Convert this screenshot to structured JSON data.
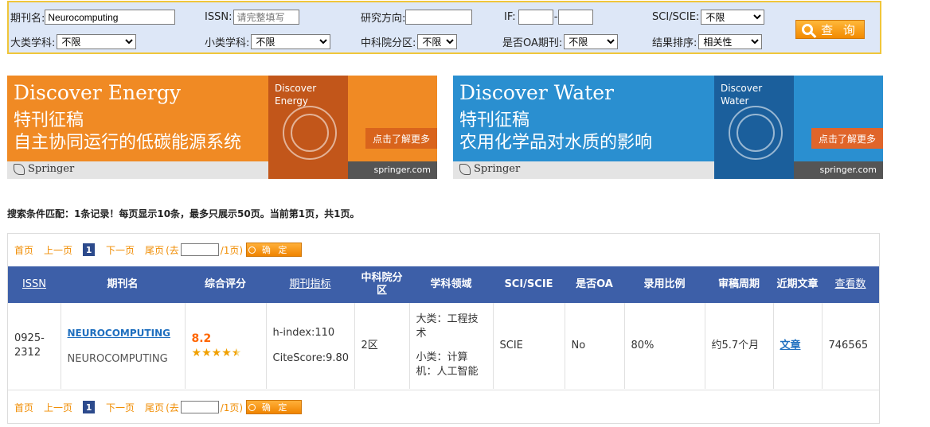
{
  "search": {
    "journal_label": "期刊名:",
    "journal_value": "Neurocomputing",
    "issn_label": "ISSN:",
    "issn_placeholder": "请完整填写",
    "research_label": "研究方向:",
    "research_value": "",
    "if_label": "IF:",
    "if_min": "",
    "if_dash": "-",
    "if_max": "",
    "sci_label": "SCI/SCIE:",
    "sci_value": "不限",
    "major_label": "大类学科:",
    "major_value": "不限",
    "minor_label": "小类学科:",
    "minor_value": "不限",
    "cas_label": "中科院分区:",
    "cas_value": "不限",
    "oa_label": "是否OA期刊:",
    "oa_value": "不限",
    "sort_label": "结果排序:",
    "sort_value": "相关性",
    "query_label": "查 询"
  },
  "banners": [
    {
      "title_en": "Discover Energy",
      "title_zh1": "特刊征稿",
      "title_zh2": "自主协同运行的低碳能源系统",
      "cover_title": "Discover\nEnergy",
      "learn_more": "点击了解更多",
      "brand": "Springer",
      "site": "springer.com",
      "bg_color": "#f08a24",
      "cover_color": "#c2561a"
    },
    {
      "title_en": "Discover Water",
      "title_zh1": "特刊征稿",
      "title_zh2": "农用化学品对水质的影响",
      "cover_title": "Discover\nWater",
      "learn_more": "点击了解更多",
      "brand": "Springer",
      "site": "springer.com",
      "bg_color": "#2a8fd0",
      "cover_color": "#1b5f9c"
    }
  ],
  "summary": "搜索条件匹配：1条记录！每页显示10条，最多只展示50页。当前第1页，共1页。",
  "pager": {
    "first": "首页",
    "prev": "上一页",
    "current": "1",
    "next": "下一页",
    "last": "尾页",
    "goto_prefix": "(去",
    "goto_suffix": "/1页)",
    "ok": "确 定"
  },
  "table": {
    "headers": [
      "ISSN",
      "期刊名",
      "综合评分",
      "期刊指标",
      "中科院分区",
      "学科领域",
      "SCI/SCIE",
      "是否OA",
      "录用比例",
      "审稿周期",
      "近期文章",
      "查看数"
    ],
    "rows": [
      {
        "issn": "0925-2312",
        "journal_link": "NEUROCOMPUTING",
        "journal_sub": "NEUROCOMPUTING",
        "score": "8.2",
        "stars": 4.5,
        "h_index": "h-index:110",
        "citescore": "CiteScore:9.80",
        "cas_zone": "2区",
        "major": "大类：工程技术",
        "minor": "小类：计算机：人工智能",
        "sci": "SCIE",
        "oa": "No",
        "accept_rate": "80%",
        "review_cycle": "约5.7个月",
        "recent": "文章",
        "views": "746565"
      }
    ]
  }
}
